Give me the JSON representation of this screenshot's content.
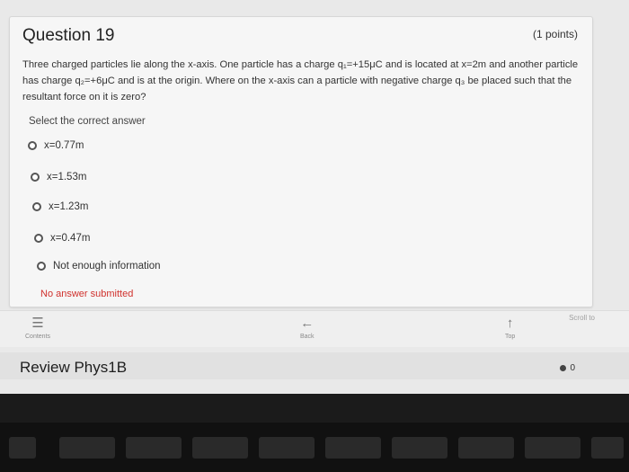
{
  "question": {
    "title": "Question 19",
    "points": "(1 points)",
    "text": "Three charged particles lie along the x-axis. One particle has a charge q₁=+15μC and is located at x=2m and another particle has charge q₂=+6μC and is at the origin. Where on the x-axis can a particle with negative charge q₃ be placed such that the resultant force on it is zero?",
    "instruction": "Select the correct answer",
    "options": [
      {
        "label": "x=0.77m"
      },
      {
        "label": "x=1.53m"
      },
      {
        "label": "x=1.23m"
      },
      {
        "label": "x=0.47m"
      },
      {
        "label": "Not enough information"
      }
    ],
    "status": "No answer submitted"
  },
  "nav": {
    "contents": "Contents",
    "back": "Back",
    "top": "Top",
    "scroll_to": "Scroll to"
  },
  "footer": {
    "title": "Review Phys1B",
    "badge_count": "0"
  },
  "icons": {
    "contents": "list-icon",
    "back": "arrow-left-icon",
    "top": "arrow-up-icon"
  },
  "colors": {
    "status_text": "#d0312d"
  }
}
